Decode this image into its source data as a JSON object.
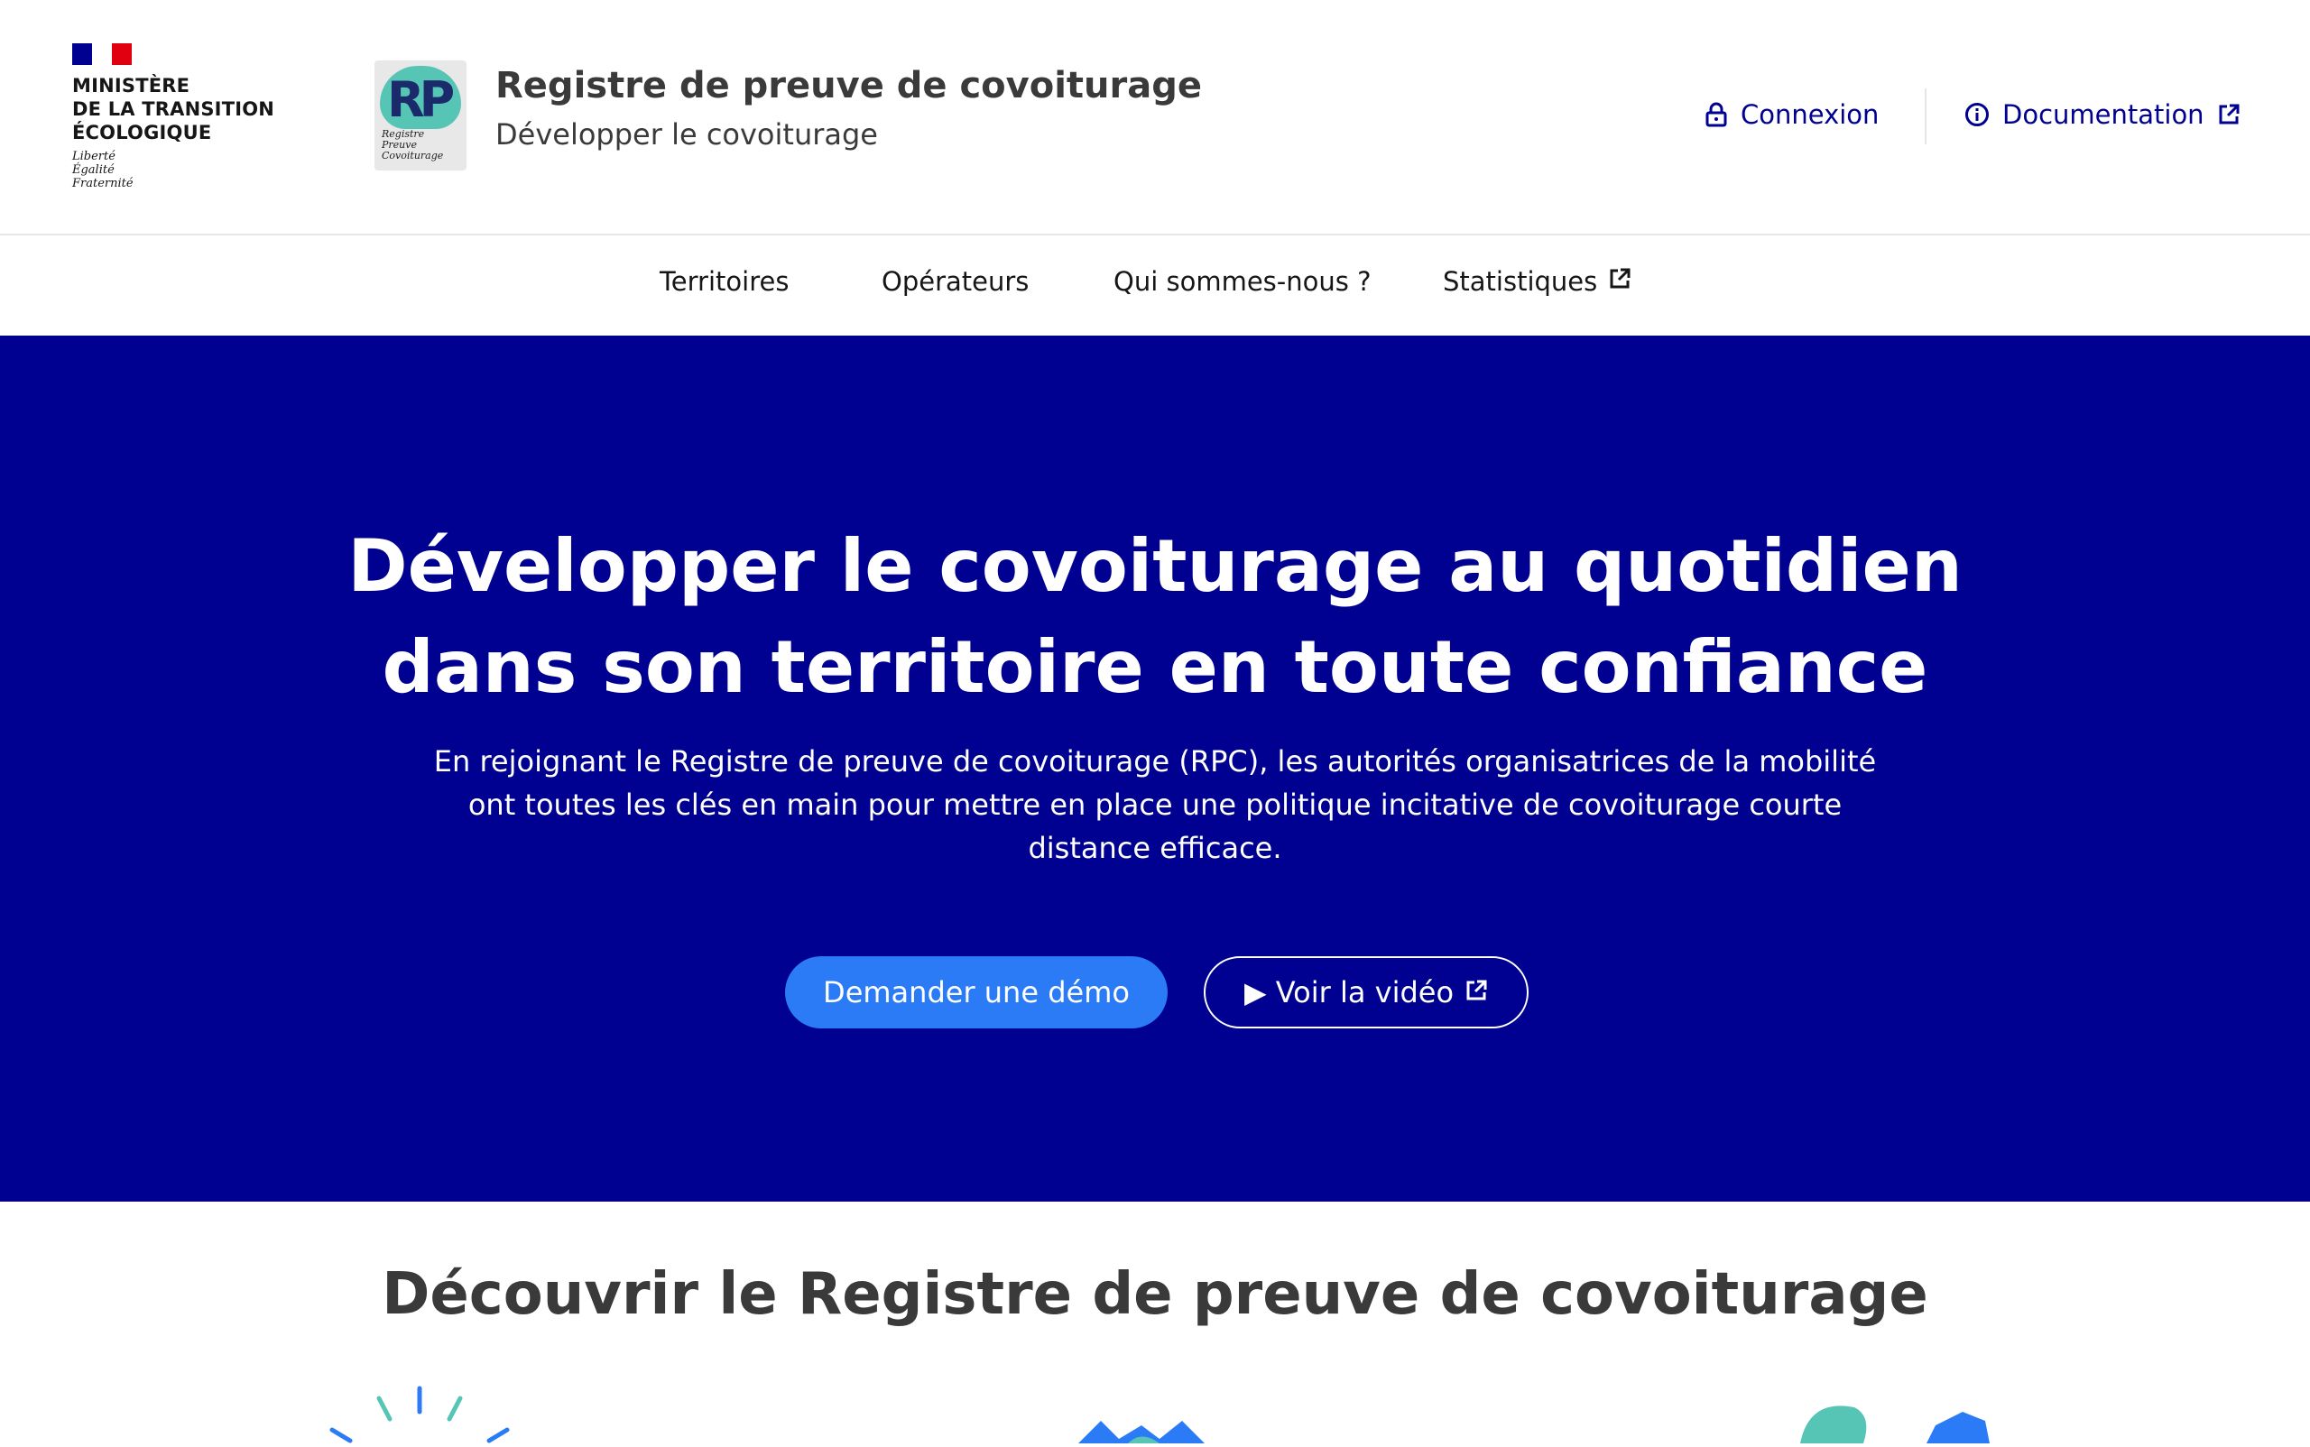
{
  "colors": {
    "primary": "#000091",
    "accent_button": "#2a7bf5",
    "text_dark": "#3a3a3a",
    "flag_blue": "#000091",
    "flag_red": "#e1000f",
    "logo_teal": "#57c5b6"
  },
  "header": {
    "ministry_name": "MINISTÈRE\nDE LA TRANSITION\nÉCOLOGIQUE",
    "motto": "Liberté\nÉgalité\nFraternité",
    "app_logo": {
      "letters": "RP",
      "caption": "Registre\nPreuve\nCovoiturage"
    },
    "site_title": "Registre de preuve de covoiturage",
    "site_tagline": "Développer le covoiturage",
    "tools": {
      "login": {
        "label": "Connexion",
        "icon": "lock-icon"
      },
      "docs": {
        "label": "Documentation",
        "icon": "info-icon",
        "external_icon": "external-link-icon"
      }
    }
  },
  "nav": {
    "items": [
      {
        "label": "Territoires"
      },
      {
        "label": "Opérateurs"
      },
      {
        "label": "Qui sommes-nous ?"
      },
      {
        "label": "Statistiques",
        "external": true
      }
    ]
  },
  "hero": {
    "title": "Développer le covoiturage au quotidien dans son territoire en toute confiance",
    "text": "En rejoignant le Registre de preuve de covoiturage (RPC), les autorités organisatrices de la mobilité ont toutes les clés en main pour mettre en place une politique incitative de covoiturage courte distance efficace.",
    "primary_button": "Demander une démo",
    "secondary_button": "▶ Voir la vidéo"
  },
  "discover": {
    "title": "Découvrir le Registre de preuve de covoiturage"
  }
}
